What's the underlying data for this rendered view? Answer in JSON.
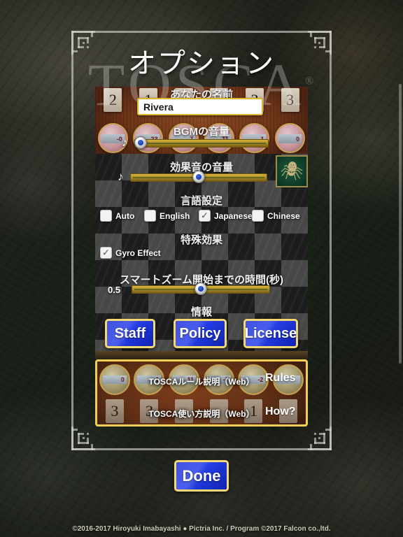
{
  "screen": {
    "title": "オプション",
    "watermark": "TOSCA",
    "watermark_mark": "®"
  },
  "name_section": {
    "label": "あなたの名前",
    "value": "Rivera",
    "placeholder": "あなたの名前"
  },
  "bgm_section": {
    "label": "BGMの音量",
    "note_icon": "♪",
    "value": 0,
    "min": 0,
    "max": 100,
    "percent": "0%"
  },
  "se_section": {
    "label": "効果音の音量",
    "note_icon": "♪",
    "value": 50,
    "min": 0,
    "max": 100,
    "percent": "50%"
  },
  "language_section": {
    "label": "言語設定",
    "options": [
      {
        "label": "Auto",
        "checked": false
      },
      {
        "label": "English",
        "checked": false
      },
      {
        "label": "Japanese",
        "checked": true
      },
      {
        "label": "Chinese",
        "checked": false
      }
    ]
  },
  "effects_section": {
    "label": "特殊効果",
    "options": [
      {
        "label": "Gyro Effect",
        "checked": true
      }
    ]
  },
  "smartzoom_section": {
    "label": "スマートズーム開始までの時間(秒)",
    "value": "0.5",
    "percent": "50%"
  },
  "info_section": {
    "label": "情報",
    "buttons": [
      {
        "label": "Staff"
      },
      {
        "label": "Policy"
      },
      {
        "label": "License"
      }
    ]
  },
  "web_links": [
    {
      "label": "TOSCAルール説明（Web）",
      "action": "Rules",
      "color": "#9a9a9a"
    },
    {
      "label": "TOSCA使い方説明（Web）",
      "action": "How?",
      "color": "#3fc9a8"
    }
  ],
  "done_button": {
    "label": "Done"
  },
  "footer": {
    "text": "©2016-2017 Hiroyuki Imabayashi ● Pictria Inc. / Program ©2017 Falcon co.,ltd."
  },
  "board_decor": {
    "top_numbers": [
      "2",
      "1",
      "",
      "",
      "3",
      "3"
    ],
    "top_dials": [
      "-0",
      "-23",
      "-7",
      "11",
      "1",
      "0"
    ],
    "link_dials": [
      "0",
      "1",
      "11",
      "-7",
      "-2",
      ""
    ],
    "link_numbers": [
      "3",
      "3",
      "",
      "",
      "1",
      ""
    ],
    "spider_icon": "🕷"
  },
  "colors": {
    "accent_gold": "#f0cf53",
    "button_blue": "#1b2fd6",
    "rules_gray": "#9a9a9a",
    "how_teal": "#3fc9a8",
    "checkbox_bg": "#f2f2f2",
    "input_bg": "#ffffff"
  }
}
